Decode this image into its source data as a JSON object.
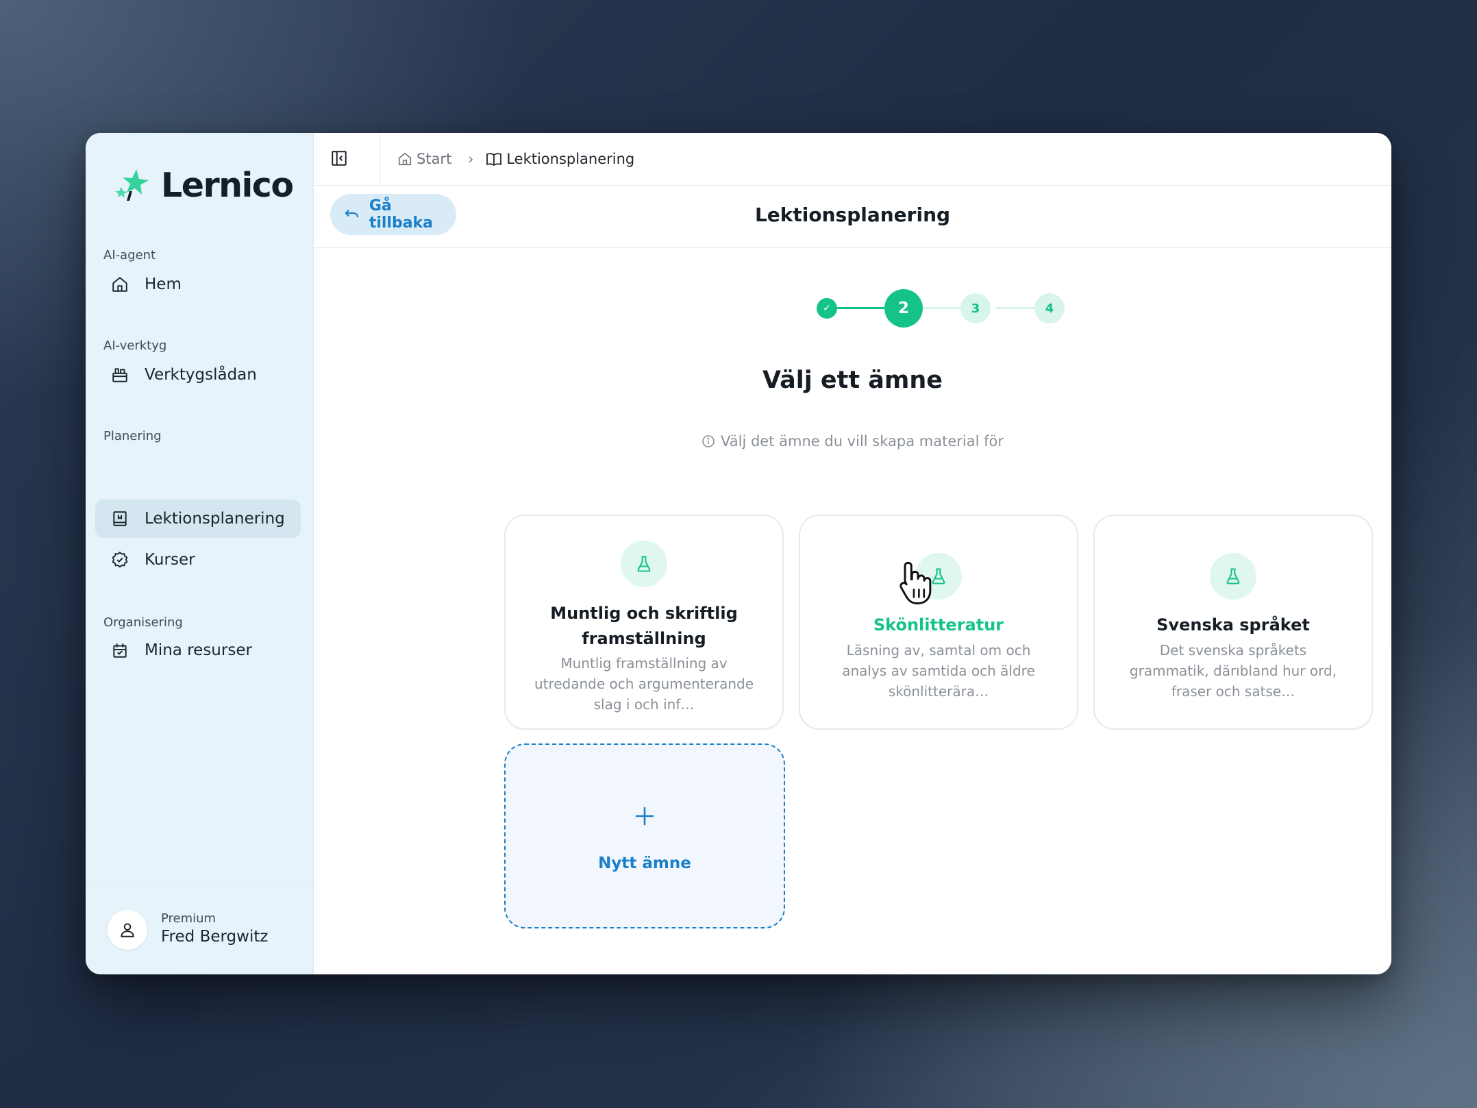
{
  "app": {
    "logo_text": "Lernico"
  },
  "sidebar": {
    "sections": [
      {
        "label": "AI-agent",
        "items": [
          {
            "label": "Hem",
            "icon": "home-icon"
          }
        ]
      },
      {
        "label": "AI-verktyg",
        "items": [
          {
            "label": "Verktygslådan",
            "icon": "toolbox-icon"
          }
        ]
      },
      {
        "label": "Planering",
        "items": [
          {
            "label": "Lektionsplanering",
            "icon": "lesson-plan-icon",
            "active": true
          },
          {
            "label": "Kurser",
            "icon": "badge-icon"
          }
        ]
      },
      {
        "label": "Organisering",
        "items": [
          {
            "label": "Mina resurser",
            "icon": "calendar-icon"
          }
        ]
      }
    ],
    "user": {
      "plan": "Premium",
      "name": "Fred Bergwitz"
    }
  },
  "breadcrumb": {
    "items": [
      {
        "label": "Start",
        "icon": "home-icon"
      },
      {
        "label": "Lektionsplanering",
        "icon": "book-icon"
      }
    ]
  },
  "header": {
    "back_label": "Gå tillbaka",
    "title": "Lektionsplanering"
  },
  "stepper": {
    "steps": [
      {
        "label": "✓",
        "state": "done"
      },
      {
        "label": "2",
        "state": "current"
      },
      {
        "label": "3",
        "state": "upcoming"
      },
      {
        "label": "4",
        "state": "upcoming"
      }
    ]
  },
  "content": {
    "title": "Välj ett ämne",
    "hint": "Välj det ämne du vill skapa material för",
    "subjects": [
      {
        "title": "Muntlig och skriftlig framställning",
        "description": "Muntlig framställning av utredande och argumenterande slag i och inf…",
        "icon": "flask-icon"
      },
      {
        "title": "Skönlitteratur",
        "description": "Läsning av, samtal om och analys av samtida och äldre skönlitterära…",
        "icon": "flask-icon",
        "hovered": true
      },
      {
        "title": "Svenska språket",
        "description": "Det svenska språkets grammatik, därıbland hur ord, fraser och satse…",
        "icon": "flask-icon"
      }
    ],
    "new_subject_label": "Nytt ämne"
  },
  "colors": {
    "accent_green": "#15c389",
    "accent_blue": "#1b7fc8",
    "sidebar_bg": "#e6f3fb"
  }
}
